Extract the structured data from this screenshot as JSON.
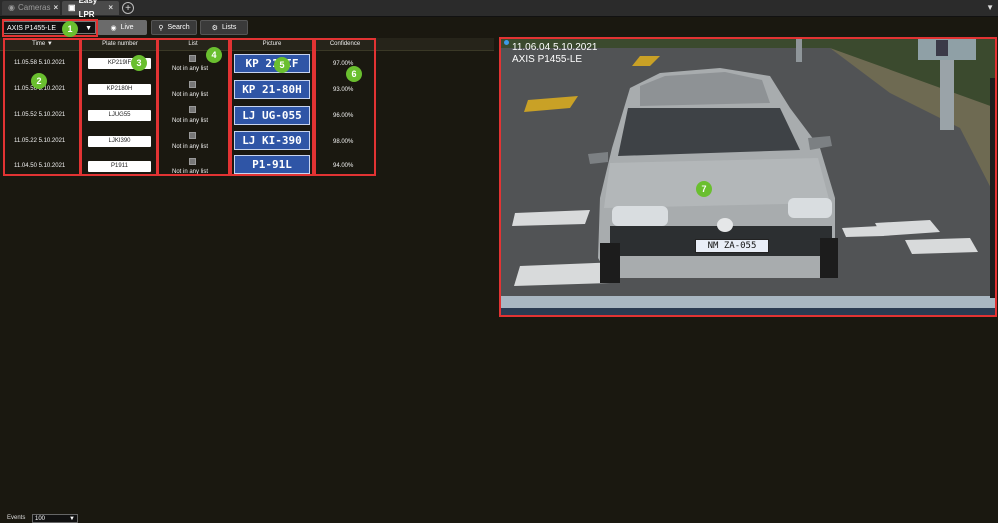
{
  "tabs": [
    {
      "label": "Cameras",
      "icon": "camera-icon",
      "active": false
    },
    {
      "label": "Easy LPR",
      "icon": "car-icon",
      "active": true
    }
  ],
  "toolbar": {
    "camera_select": "AXIS P1455-LE",
    "live_label": "Live",
    "search_label": "Search",
    "lists_label": "Lists"
  },
  "table": {
    "columns": {
      "time": "Time",
      "plate": "Plate number",
      "list": "List",
      "picture": "Picture",
      "confidence": "Confidence"
    },
    "rows": [
      {
        "time": "11.05.58 5.10.2021",
        "plate": "KP219IF",
        "list": "Not in any list",
        "picture": "KP 219IF",
        "confidence": "97.00%"
      },
      {
        "time": "11.05.56 5.10.2021",
        "plate": "KP2180H",
        "list": "Not in any list",
        "picture": "KP 21-80H",
        "confidence": "93.00%"
      },
      {
        "time": "11.05.52 5.10.2021",
        "plate": "LJUG55",
        "list": "Not in any list",
        "picture": "LJ UG-055",
        "confidence": "96.00%"
      },
      {
        "time": "11.05.22 5.10.2021",
        "plate": "LJKI390",
        "list": "Not in any list",
        "picture": "LJ KI-390",
        "confidence": "98.00%"
      },
      {
        "time": "11.04.50 5.10.2021",
        "plate": "P1911",
        "list": "Not in any list",
        "picture": "P1-91L",
        "confidence": "94.00%"
      }
    ]
  },
  "video": {
    "timestamp": "11.06.04 5.10.2021",
    "camera_name": "AXIS P1455-LE",
    "plate": "NM ZA-055"
  },
  "callouts": [
    "1",
    "2",
    "3",
    "4",
    "5",
    "6",
    "7"
  ],
  "footer": {
    "events_label": "Events",
    "events_value": "100"
  },
  "colors": {
    "highlight": "#e23333",
    "badge": "#6abf2f",
    "plate_blue": "#2f55a6"
  }
}
